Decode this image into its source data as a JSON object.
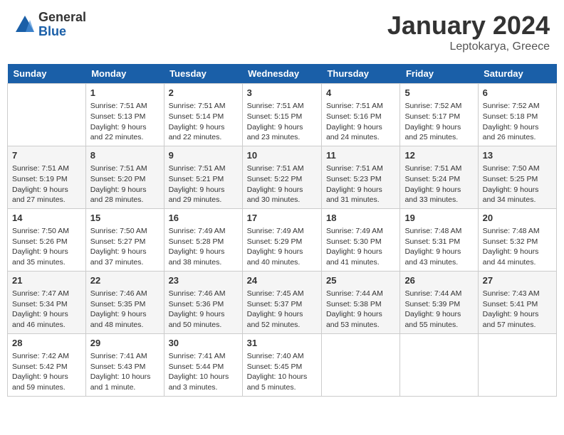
{
  "header": {
    "logo_general": "General",
    "logo_blue": "Blue",
    "title": "January 2024",
    "subtitle": "Leptokarya, Greece"
  },
  "columns": [
    "Sunday",
    "Monday",
    "Tuesday",
    "Wednesday",
    "Thursday",
    "Friday",
    "Saturday"
  ],
  "weeks": [
    [
      {
        "num": "",
        "info": ""
      },
      {
        "num": "1",
        "info": "Sunrise: 7:51 AM\nSunset: 5:13 PM\nDaylight: 9 hours\nand 22 minutes."
      },
      {
        "num": "2",
        "info": "Sunrise: 7:51 AM\nSunset: 5:14 PM\nDaylight: 9 hours\nand 22 minutes."
      },
      {
        "num": "3",
        "info": "Sunrise: 7:51 AM\nSunset: 5:15 PM\nDaylight: 9 hours\nand 23 minutes."
      },
      {
        "num": "4",
        "info": "Sunrise: 7:51 AM\nSunset: 5:16 PM\nDaylight: 9 hours\nand 24 minutes."
      },
      {
        "num": "5",
        "info": "Sunrise: 7:52 AM\nSunset: 5:17 PM\nDaylight: 9 hours\nand 25 minutes."
      },
      {
        "num": "6",
        "info": "Sunrise: 7:52 AM\nSunset: 5:18 PM\nDaylight: 9 hours\nand 26 minutes."
      }
    ],
    [
      {
        "num": "7",
        "info": "Sunrise: 7:51 AM\nSunset: 5:19 PM\nDaylight: 9 hours\nand 27 minutes."
      },
      {
        "num": "8",
        "info": "Sunrise: 7:51 AM\nSunset: 5:20 PM\nDaylight: 9 hours\nand 28 minutes."
      },
      {
        "num": "9",
        "info": "Sunrise: 7:51 AM\nSunset: 5:21 PM\nDaylight: 9 hours\nand 29 minutes."
      },
      {
        "num": "10",
        "info": "Sunrise: 7:51 AM\nSunset: 5:22 PM\nDaylight: 9 hours\nand 30 minutes."
      },
      {
        "num": "11",
        "info": "Sunrise: 7:51 AM\nSunset: 5:23 PM\nDaylight: 9 hours\nand 31 minutes."
      },
      {
        "num": "12",
        "info": "Sunrise: 7:51 AM\nSunset: 5:24 PM\nDaylight: 9 hours\nand 33 minutes."
      },
      {
        "num": "13",
        "info": "Sunrise: 7:50 AM\nSunset: 5:25 PM\nDaylight: 9 hours\nand 34 minutes."
      }
    ],
    [
      {
        "num": "14",
        "info": "Sunrise: 7:50 AM\nSunset: 5:26 PM\nDaylight: 9 hours\nand 35 minutes."
      },
      {
        "num": "15",
        "info": "Sunrise: 7:50 AM\nSunset: 5:27 PM\nDaylight: 9 hours\nand 37 minutes."
      },
      {
        "num": "16",
        "info": "Sunrise: 7:49 AM\nSunset: 5:28 PM\nDaylight: 9 hours\nand 38 minutes."
      },
      {
        "num": "17",
        "info": "Sunrise: 7:49 AM\nSunset: 5:29 PM\nDaylight: 9 hours\nand 40 minutes."
      },
      {
        "num": "18",
        "info": "Sunrise: 7:49 AM\nSunset: 5:30 PM\nDaylight: 9 hours\nand 41 minutes."
      },
      {
        "num": "19",
        "info": "Sunrise: 7:48 AM\nSunset: 5:31 PM\nDaylight: 9 hours\nand 43 minutes."
      },
      {
        "num": "20",
        "info": "Sunrise: 7:48 AM\nSunset: 5:32 PM\nDaylight: 9 hours\nand 44 minutes."
      }
    ],
    [
      {
        "num": "21",
        "info": "Sunrise: 7:47 AM\nSunset: 5:34 PM\nDaylight: 9 hours\nand 46 minutes."
      },
      {
        "num": "22",
        "info": "Sunrise: 7:46 AM\nSunset: 5:35 PM\nDaylight: 9 hours\nand 48 minutes."
      },
      {
        "num": "23",
        "info": "Sunrise: 7:46 AM\nSunset: 5:36 PM\nDaylight: 9 hours\nand 50 minutes."
      },
      {
        "num": "24",
        "info": "Sunrise: 7:45 AM\nSunset: 5:37 PM\nDaylight: 9 hours\nand 52 minutes."
      },
      {
        "num": "25",
        "info": "Sunrise: 7:44 AM\nSunset: 5:38 PM\nDaylight: 9 hours\nand 53 minutes."
      },
      {
        "num": "26",
        "info": "Sunrise: 7:44 AM\nSunset: 5:39 PM\nDaylight: 9 hours\nand 55 minutes."
      },
      {
        "num": "27",
        "info": "Sunrise: 7:43 AM\nSunset: 5:41 PM\nDaylight: 9 hours\nand 57 minutes."
      }
    ],
    [
      {
        "num": "28",
        "info": "Sunrise: 7:42 AM\nSunset: 5:42 PM\nDaylight: 9 hours\nand 59 minutes."
      },
      {
        "num": "29",
        "info": "Sunrise: 7:41 AM\nSunset: 5:43 PM\nDaylight: 10 hours\nand 1 minute."
      },
      {
        "num": "30",
        "info": "Sunrise: 7:41 AM\nSunset: 5:44 PM\nDaylight: 10 hours\nand 3 minutes."
      },
      {
        "num": "31",
        "info": "Sunrise: 7:40 AM\nSunset: 5:45 PM\nDaylight: 10 hours\nand 5 minutes."
      },
      {
        "num": "",
        "info": ""
      },
      {
        "num": "",
        "info": ""
      },
      {
        "num": "",
        "info": ""
      }
    ]
  ]
}
